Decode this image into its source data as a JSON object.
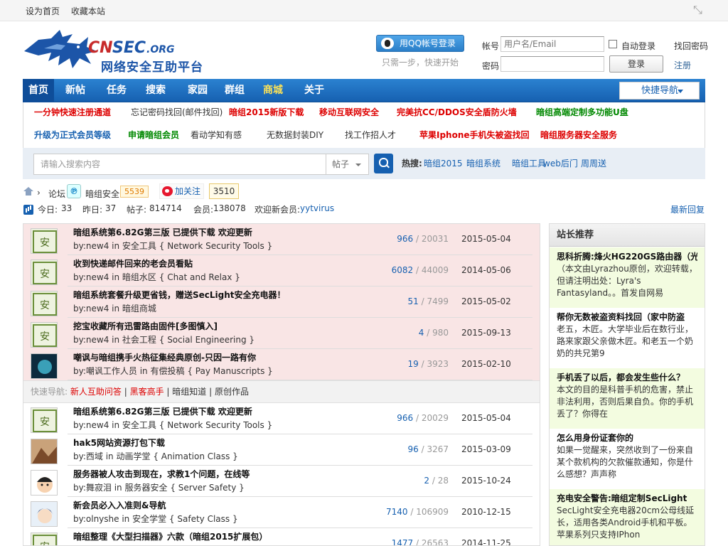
{
  "topbar": {
    "home": "设为首页",
    "fav": "收藏本站"
  },
  "header": {
    "logo_text": "CNSEC.ORG",
    "logo_sub": "网络安全互助平台",
    "qq_label": "用QQ帐号登录",
    "qq_tip": "只需一步，快速开始",
    "user_label": "帐号",
    "user_placeholder": "用户名/Email",
    "remember": "自动登录",
    "forgot": "找回密码",
    "pass_label": "密码",
    "login": "登录",
    "register": "注册"
  },
  "nav": {
    "items": [
      "首页",
      "新帖",
      "任务",
      "搜索",
      "家园",
      "群组",
      "商城",
      "关于"
    ],
    "quick": "快捷导航"
  },
  "promo": [
    {
      "text": "一分钟快速注册通道",
      "color": "#dd0000"
    },
    {
      "text": "忘记密码找回(邮件找回)",
      "color": "#333333"
    },
    {
      "text": "暗组2015新版下载",
      "color": "#dd0000"
    },
    {
      "text": "移动互联网安全",
      "color": "#dd0000"
    },
    {
      "text": "完美抗CC/DDOS安全盾防火墙",
      "color": "#dd0000"
    },
    {
      "text": "暗组高端定制多功能U盘",
      "color": "#008800"
    },
    {
      "text": "升级为正式会员等级",
      "color": "#1660b0"
    },
    {
      "text": "申请暗组会员",
      "color": "#008800"
    },
    {
      "text": "看动学知有感",
      "color": "#333333"
    },
    {
      "text": "无数据封装DIY",
      "color": "#333333"
    },
    {
      "text": "找工作招人才",
      "color": "#333333"
    },
    {
      "text": "苹果Iphone手机失被盗找回",
      "color": "#dd0000"
    },
    {
      "text": "暗组服务器安全服务",
      "color": "#dd0000"
    }
  ],
  "search": {
    "placeholder": "请输入搜索内容",
    "type": "帖子",
    "hot_label": "热搜:",
    "hot": [
      "暗组2015",
      "暗组系统",
      "暗组工具",
      "web后门",
      "周周送"
    ]
  },
  "crumb": {
    "sep1": "›",
    "forum": "论坛",
    "sep2": "›",
    "board": "暗组安全",
    "count": "5539",
    "follow": "加关注",
    "fans": "3510"
  },
  "stats": {
    "today_label": "今日:",
    "today": "33",
    "yest_label": "昨日:",
    "yest": "37",
    "posts_label": "帖子:",
    "posts": "814714",
    "members_label": "会员:",
    "members": "138078",
    "new_label": "欢迎新会员:",
    "new_user": "yytvirus",
    "recent": "最新回复"
  },
  "pinned": [
    {
      "title": "暗组系统第6.82G第三版 已提供下载 欢迎更新",
      "by": "new4",
      "forum": "安全工具",
      "sub": "Network Security Tools",
      "replies": "966",
      "views": "20031",
      "date": "2015-05-04"
    },
    {
      "title": "收到快递邮件回来的老会员看贴",
      "by": "new4",
      "forum": "暗组水区",
      "sub": "Chat and Relax",
      "replies": "6082",
      "views": "44009",
      "date": "2014-05-06"
    },
    {
      "title": "暗组系统套餐升级更省钱，赠送SecLight安全充电器！",
      "by": "new4",
      "forum": "暗组商城",
      "sub": "",
      "replies": "51",
      "views": "7499",
      "date": "2015-05-02"
    },
    {
      "title": "挖宝收藏所有迅雷路由固件[多图慎入]",
      "by": "new4",
      "forum": "社会工程",
      "sub": "Social Engineering",
      "replies": "4",
      "views": "980",
      "date": "2015-09-13"
    },
    {
      "title": "嘲讽与暗组携手火热征集经典原创-只因一路有你",
      "by": "嘲讽工作人员",
      "forum": "有偿投稿",
      "sub": "Pay Manuscripts",
      "replies": "19",
      "views": "3923",
      "date": "2015-02-10"
    }
  ],
  "quicknav": {
    "label": "快速导航:",
    "items": [
      "新人互助问答",
      "黑客高手",
      "暗组知道",
      "原创作品"
    ]
  },
  "threads": [
    {
      "title": "暗组系统第6.82G第三版 已提供下载 欢迎更新",
      "by": "new4",
      "forum": "安全工具",
      "sub": "Network Security Tools",
      "replies": "966",
      "views": "20029",
      "date": "2015-05-04"
    },
    {
      "title": "hak5网站资源打包下载",
      "by": "西域",
      "forum": "动画学堂",
      "sub": "Animation Class",
      "replies": "96",
      "views": "3267",
      "date": "2015-03-09"
    },
    {
      "title": "服务器被人攻击到现在，求教1个问题，在线等",
      "by": "舞寂泪",
      "forum": "服务器安全",
      "sub": "Server Safety",
      "replies": "2",
      "views": "28",
      "date": "2015-10-24"
    },
    {
      "title": "新会员必入入准则&导航",
      "by": "olnyshe",
      "forum": "安全学堂",
      "sub": "Safety Class",
      "replies": "7140",
      "views": "106909",
      "date": "2010-12-15"
    },
    {
      "title": "暗组整理《大型扫描器》六款（暗组2015扩展包）",
      "by": "",
      "forum": "",
      "sub": "",
      "replies": "1477",
      "views": "26563",
      "date": "2014-11-25"
    }
  ],
  "sidebar": {
    "title": "站长推荐",
    "items": [
      {
        "title": "思科折腾:烽火HG220GS路由器（光",
        "desc": "（本文由Lyrazhou原创，欢迎转载，但请注明出处：Lyra's Fantasyland。。首发自网易"
      },
      {
        "title": "帮你无数被盗资料找回（家中防盗",
        "desc": "老五，木匠。大学毕业后在数行业，路来家跟父亲做木匠。和老五一个奶奶的共兄第9"
      },
      {
        "title": "手机丢了以后，都会发生些什么？",
        "desc": "本文的目的是科普手机的危害，禁止非法利用，否则后果自负。你的手机丢了？你得在"
      },
      {
        "title": "怎么用身份证套你的",
        "desc": "如果一觉醒来，突然收到了一份来自某个款机构的欠款催款通知，你是什么感想？声声称"
      },
      {
        "title": "充电安全警告:暗组定制SecLight",
        "desc": "SecLight安全充电器20cm公母线延长，适用各类Android手机和平板。苹果系列只支持IPhon"
      }
    ]
  },
  "colors": {
    "nav": "#1660b0",
    "pinned_bg": "#f9e5e5",
    "sidebar_green": "#f3fce0",
    "link": "#1660b0"
  }
}
